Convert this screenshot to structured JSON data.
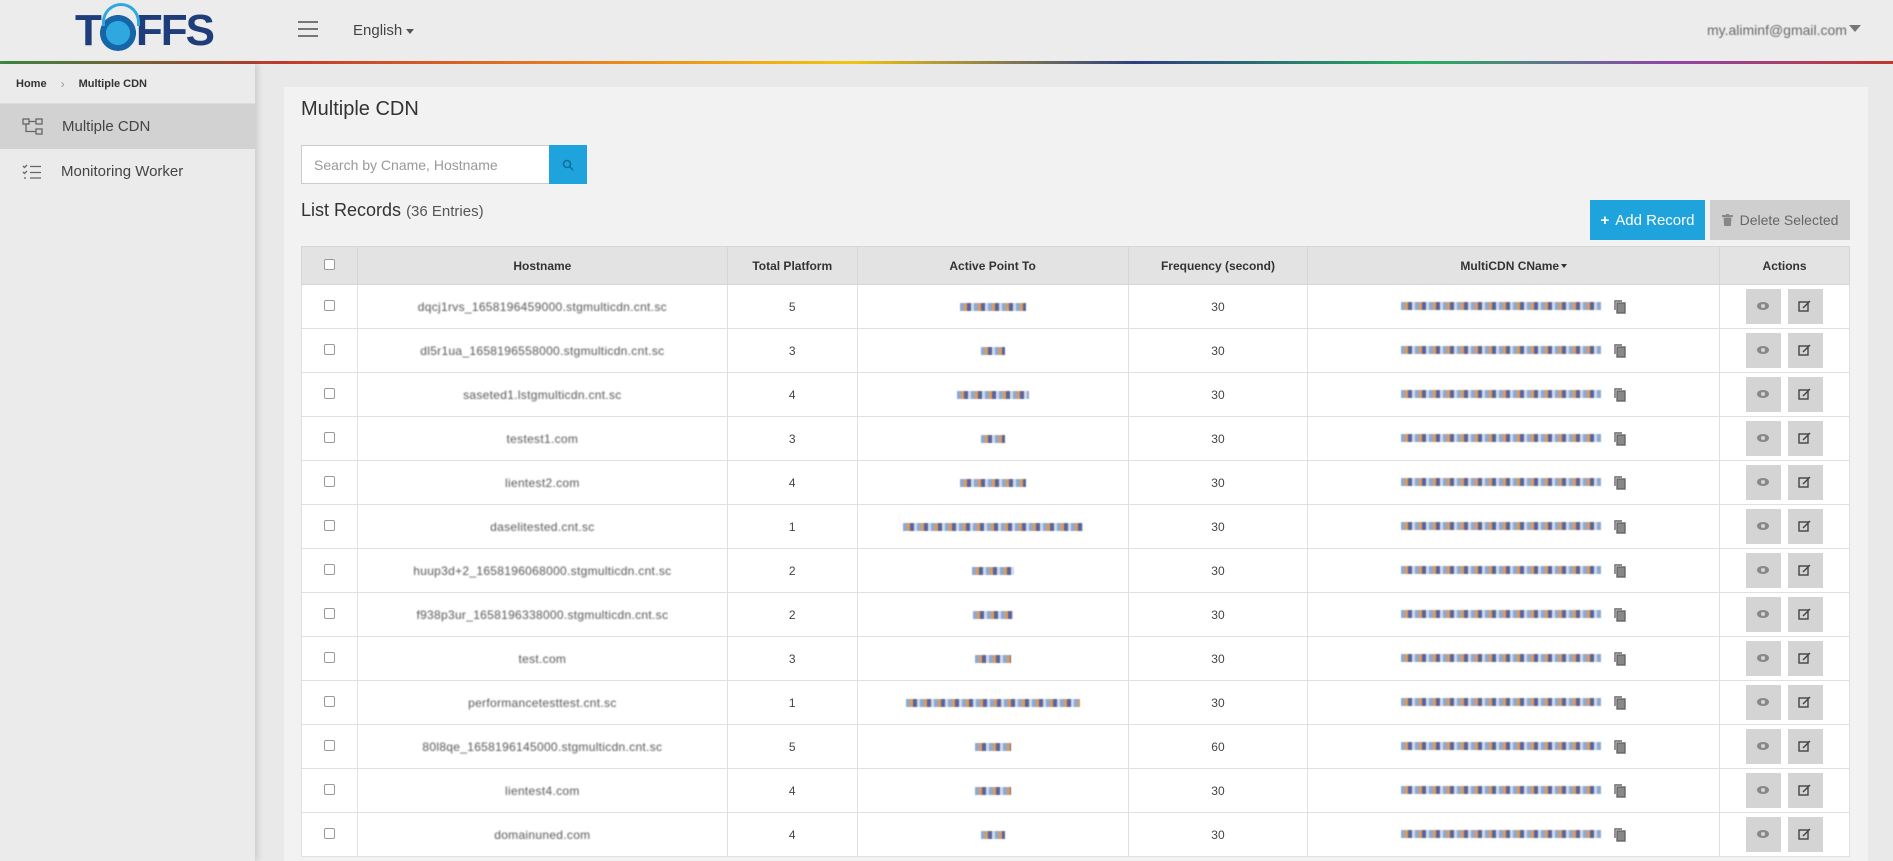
{
  "header": {
    "language": "English",
    "user_email": "my.aliminf@gmail.com"
  },
  "breadcrumb": {
    "home": "Home",
    "current": "Multiple CDN"
  },
  "sidebar": {
    "items": [
      {
        "label": "Multiple CDN",
        "icon": "network-icon",
        "active": true
      },
      {
        "label": "Monitoring Worker",
        "icon": "checklist-icon",
        "active": false
      }
    ]
  },
  "main": {
    "title": "Multiple CDN",
    "search_placeholder": "Search by Cname, Hostname",
    "list_title": "List Records",
    "list_count": "(36 Entries)",
    "add_label": "Add Record",
    "delete_label": "Delete Selected"
  },
  "table": {
    "headers": [
      "Hostname",
      "Total Platform",
      "Active Point To",
      "Frequency (second)",
      "MultiCDN CName",
      "Actions"
    ],
    "rows": [
      {
        "hostname": "dqcj1rvs_1658196459000.stgmulticdn.cnt.sc",
        "total": "5",
        "freq": "30",
        "ap_w": 66,
        "cn_w": 200
      },
      {
        "hostname": "dl5r1ua_1658196558000.stgmulticdn.cnt.sc",
        "total": "3",
        "freq": "30",
        "ap_w": 24,
        "cn_w": 200
      },
      {
        "hostname": "saseted1.lstgmulticdn.cnt.sc",
        "total": "4",
        "freq": "30",
        "ap_w": 72,
        "cn_w": 200
      },
      {
        "hostname": "testest1.com",
        "total": "3",
        "freq": "30",
        "ap_w": 24,
        "cn_w": 200
      },
      {
        "hostname": "lientest2.com",
        "total": "4",
        "freq": "30",
        "ap_w": 66,
        "cn_w": 200
      },
      {
        "hostname": "daselitested.cnt.sc",
        "total": "1",
        "freq": "30",
        "ap_w": 180,
        "cn_w": 200
      },
      {
        "hostname": "huup3d+2_1658196068000.stgmulticdn.cnt.sc",
        "total": "2",
        "freq": "30",
        "ap_w": 42,
        "cn_w": 200
      },
      {
        "hostname": "f938p3ur_1658196338000.stgmulticdn.cnt.sc",
        "total": "2",
        "freq": "30",
        "ap_w": 40,
        "cn_w": 200
      },
      {
        "hostname": "test.com",
        "total": "3",
        "freq": "30",
        "ap_w": 36,
        "cn_w": 200
      },
      {
        "hostname": "performancetesttest.cnt.sc",
        "total": "1",
        "freq": "30",
        "ap_w": 174,
        "cn_w": 200
      },
      {
        "hostname": "80l8qe_1658196145000.stgmulticdn.cnt.sc",
        "total": "5",
        "freq": "60",
        "ap_w": 36,
        "cn_w": 200
      },
      {
        "hostname": "lientest4.com",
        "total": "4",
        "freq": "30",
        "ap_w": 36,
        "cn_w": 200
      },
      {
        "hostname": "domainuned.com",
        "total": "4",
        "freq": "30",
        "ap_w": 24,
        "cn_w": 200
      }
    ]
  },
  "colors": {
    "accent": "#1fa3dc",
    "sidebar_active": "#d2d2d2",
    "brand": "#1f3d7a"
  }
}
